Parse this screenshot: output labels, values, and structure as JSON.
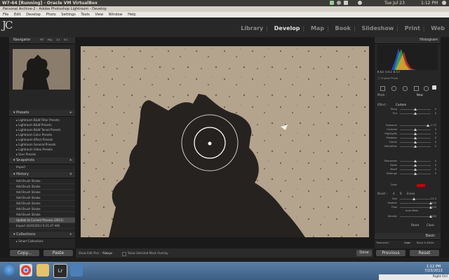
{
  "ubuntu_bar": {
    "title": "W7-64 [Running] - Oracle VM VirtualBox",
    "time": "Tue Jul 23",
    "clock": "1:12 PM"
  },
  "vbox": {
    "title": "Personal Archive-2 - Adobe Photoshop Lightroom - Develop",
    "menu": [
      "File",
      "Edit",
      "Develop",
      "Photo",
      "Settings",
      "Tools",
      "View",
      "Window",
      "Help"
    ]
  },
  "lr": {
    "logo": "JC",
    "modules": [
      "Library",
      "Develop",
      "Map",
      "Book",
      "Slideshow",
      "Print",
      "Web"
    ],
    "active_module": "Develop",
    "left": {
      "navigator": {
        "title": "Navigator",
        "zoom": [
          "FIT",
          "FILL",
          "1:1",
          "3:1"
        ]
      },
      "presets": {
        "title": "Presets",
        "items": [
          "Lightroom B&W Filter Presets",
          "Lightroom B&W Presets",
          "Lightroom B&W Toned Presets",
          "Lightroom Color Presets",
          "Lightroom Effect Presets",
          "Lightroom General Presets",
          "Lightroom Video Presets",
          "User Presets"
        ]
      },
      "snapshots": {
        "title": "Snapshots",
        "items": [
          "Import"
        ]
      },
      "history": {
        "title": "History",
        "items": [
          "Add Brush Stroke",
          "Add Brush Stroke",
          "Add Brush Stroke",
          "Add Brush Stroke",
          "Add Brush Stroke",
          "Add Brush Stroke",
          "Add Brush Stroke",
          "Update to Current Process (2012)",
          "Import (6/20/2013 9:21:07 AM)"
        ]
      },
      "collections": {
        "title": "Collections",
        "items": [
          "Smart Collections"
        ]
      },
      "copy_btn": "Copy...",
      "paste_btn": "Paste"
    },
    "right": {
      "histogram_title": "Histogram",
      "hist_values": [
        "R",
        "8.2",
        "G",
        "6.2",
        "B",
        "5.7"
      ],
      "original_photo": "Original Photo",
      "mask_label": "Mask :",
      "mask_new": "New",
      "effect_label": "Effect :",
      "effect_value": "Custom",
      "sliders": [
        {
          "label": "Temp",
          "value": "0"
        },
        {
          "label": "Tint",
          "value": "0"
        },
        {
          "label": "Exposure",
          "value": "1.75"
        },
        {
          "label": "Contrast",
          "value": "0"
        },
        {
          "label": "Highlights",
          "value": "0"
        },
        {
          "label": "Shadows",
          "value": "0"
        },
        {
          "label": "Clarity",
          "value": "0"
        },
        {
          "label": "Saturation",
          "value": "0"
        },
        {
          "label": "Sharpness",
          "value": "0"
        },
        {
          "label": "Noise",
          "value": "0"
        },
        {
          "label": "Moiré",
          "value": "0"
        },
        {
          "label": "Defringe",
          "value": "0"
        }
      ],
      "color_label": "Color",
      "color_value": "#cc0000",
      "brush_label": "Brush :",
      "brush_a": "A",
      "brush_b": "B",
      "brush_erase": "Erase",
      "brush": [
        {
          "label": "Size",
          "value": "22.0"
        },
        {
          "label": "Feather",
          "value": "100"
        },
        {
          "label": "Flow",
          "value": "100"
        },
        {
          "label": "Density",
          "value": "100"
        }
      ],
      "auto_mask": "Auto Mask",
      "reset": "Reset",
      "close": "Close",
      "basic": "Basic",
      "treatment": "Treatment :",
      "color_tab": "Color",
      "bw_tab": "Black & White",
      "previous_btn": "Previous",
      "reset_btn": "Reset"
    },
    "toolbar": {
      "show_edit_pins": "Show Edit Pins :",
      "pins_value": "Always",
      "show_overlay": "Show Selected Mask Overlay",
      "done": "Done"
    }
  },
  "taskbar": {
    "time": "1:12 PM",
    "date": "7/23/2013",
    "right_ctrl": "Right Ctrl"
  }
}
